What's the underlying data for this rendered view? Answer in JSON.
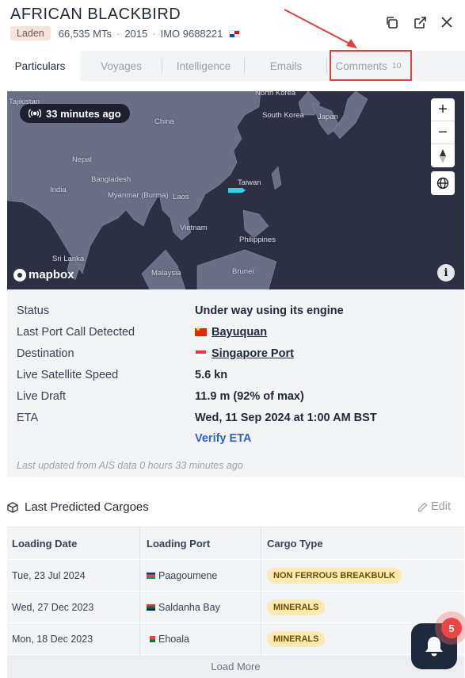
{
  "vessel": {
    "name": "AFRICAN BLACKBIRD",
    "status_badge": "Laden",
    "dwt": "66,535 MTs",
    "year": "2015",
    "imo": "IMO 9688221",
    "flag_icon": "panama-flag-icon"
  },
  "header_icons": [
    "copy-icon",
    "external-link-icon",
    "close-icon"
  ],
  "tabs": [
    {
      "label": "Particulars",
      "active": true
    },
    {
      "label": "Voyages",
      "active": false
    },
    {
      "label": "Intelligence",
      "active": false
    },
    {
      "label": "Emails",
      "active": false
    },
    {
      "label": "Comments",
      "count": "10",
      "active": false
    }
  ],
  "map": {
    "time_ago": "33 minutes ago",
    "attribution": "mapbox",
    "labels": [
      "Tajikistan",
      "North Korea",
      "South Korea",
      "Japan",
      "China",
      "Nepal",
      "Bangladesh",
      "India",
      "Myanmar (Burma)",
      "Taiwan",
      "Vietnam",
      "Philippines",
      "Sri Lanka",
      "Malaysia",
      "Brunei",
      "Laos"
    ],
    "zoom_in": "+",
    "zoom_out": "−",
    "info": "i"
  },
  "details": {
    "status": {
      "label": "Status",
      "value": "Under way using its engine"
    },
    "last_port": {
      "label": "Last Port Call Detected",
      "value": "Bayuquan",
      "flag": "china-flag-icon"
    },
    "destination": {
      "label": "Destination",
      "value": "Singapore Port",
      "flag": "singapore-flag-icon"
    },
    "speed": {
      "label": "Live Satellite Speed",
      "value": "5.6 kn"
    },
    "draft": {
      "label": "Live Draft",
      "value": "11.9 m (92% of max)"
    },
    "eta": {
      "label": "ETA",
      "value": "Wed, 11 Sep 2024 at 1:00 AM BST"
    },
    "verify_eta": "Verify ETA",
    "updated": "Last updated from AIS data 0 hours 33 minutes ago"
  },
  "cargoes": {
    "title": "Last Predicted Cargoes",
    "edit_label": "Edit",
    "columns": [
      "Loading Date",
      "Loading Port",
      "Cargo Type"
    ],
    "rows": [
      {
        "date": "Tue, 23 Jul 2024",
        "port": "Paagoumene",
        "flag": "new-caledonia-flag-icon",
        "type": "NON FERROUS BREAKBULK"
      },
      {
        "date": "Wed, 27 Dec 2023",
        "port": "Saldanha Bay",
        "flag": "south-africa-flag-icon",
        "type": "MINERALS"
      },
      {
        "date": "Mon, 18 Dec 2023",
        "port": "Ehoala",
        "flag": "madagascar-flag-icon",
        "type": "MINERALS"
      }
    ],
    "load_more": "Load More"
  },
  "notifications": {
    "count": "5"
  },
  "colors": {
    "accent_link": "#2b62d9",
    "badge_bg": "#fde9b4",
    "annotation_red": "#e53e3e",
    "map_bg": "#2d3043"
  }
}
